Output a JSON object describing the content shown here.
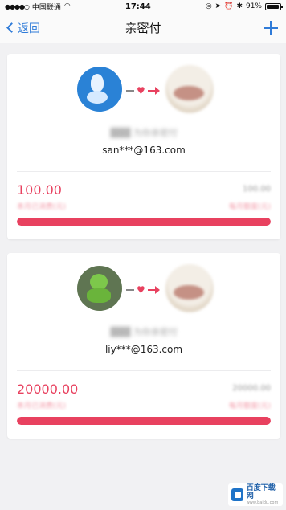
{
  "status_bar": {
    "carrier": "中国联通",
    "time": "17:44",
    "battery_percent": "91%",
    "battery_level": 0.91,
    "icons": [
      "signal-dots-icon",
      "wifi-icon",
      "orientation-lock-icon",
      "location-icon",
      "alarm-icon",
      "bluetooth-icon",
      "battery-icon"
    ]
  },
  "nav": {
    "back_label": "返回",
    "title": "亲密付",
    "add_icon": "plus-icon"
  },
  "cards": [
    {
      "name_blurred": "▓▓▓ 为你亲密付",
      "email": "san***@163.com",
      "amount": "100.00",
      "sub_left_blurred": "本月已消费(元)",
      "limit_blurred": "100.00",
      "sub_right_blurred": "每月额度(元)",
      "progress": 1.0,
      "avatar_icon": "blue-avatar-icon"
    },
    {
      "name_blurred": "▓▓▓ 为你亲密付",
      "email": "liy***@163.com",
      "amount": "20000.00",
      "sub_left_blurred": "本月已消费(元)",
      "limit_blurred": "20000.00",
      "sub_right_blurred": "每月额度(元)",
      "progress": 1.0,
      "avatar_icon": "green-avatar-icon"
    }
  ],
  "watermark": {
    "text": "百度下载网",
    "sub": "www.baidu.com"
  },
  "colors": {
    "accent": "#2f7bd8",
    "amount": "#e8415f",
    "background": "#f1f1f3"
  }
}
